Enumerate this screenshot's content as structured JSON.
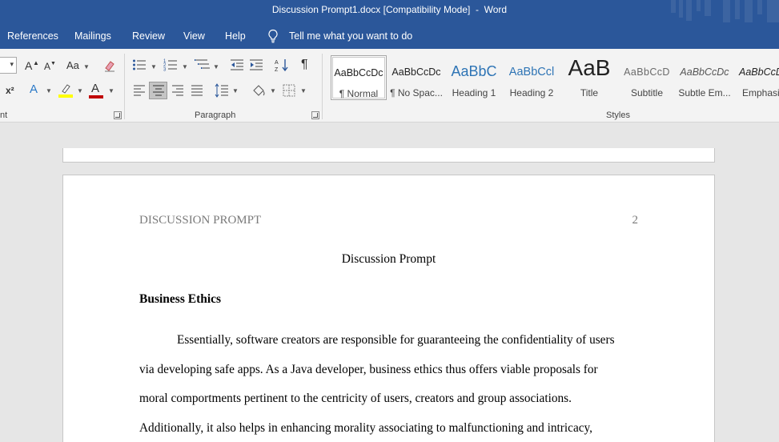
{
  "window": {
    "title": "Discussion Prompt1.docx [Compatibility Mode]  -  Word"
  },
  "menu": {
    "tabs": [
      "References",
      "Mailings",
      "Review",
      "View",
      "Help"
    ],
    "tell_me": "Tell me what you want to do"
  },
  "ribbon": {
    "groups": {
      "font_partial": "nt",
      "paragraph": "Paragraph",
      "styles": "Styles"
    },
    "font_buttons": {
      "grow": "A",
      "shrink": "A",
      "change_case": "Aa",
      "superscript": "x²",
      "text_effects": "A",
      "font_color": "A"
    },
    "highlight_color": "#ffff00",
    "font_color": "#c00000",
    "styles": [
      {
        "preview": "AaBbCcDc",
        "name": "¶ Normal",
        "selected": true
      },
      {
        "preview": "AaBbCcDc",
        "name": "¶ No Spac..."
      },
      {
        "preview": "AaBbC",
        "name": "Heading 1"
      },
      {
        "preview": "AaBbCcl",
        "name": "Heading 2"
      },
      {
        "preview": "AaB",
        "name": "Title"
      },
      {
        "preview": "AaBbCcD",
        "name": "Subtitle"
      },
      {
        "preview": "AaBbCcDc",
        "name": "Subtle Em..."
      },
      {
        "preview": "AaBbCcDc",
        "name": "Emphasis"
      }
    ]
  },
  "document": {
    "header_left": "DISCUSSION PROMPT",
    "page_number": "2",
    "title": "Discussion Prompt",
    "heading": "Business Ethics",
    "lines": [
      "Essentially, software creators are responsible for guaranteeing the confidentiality of users",
      "via developing safe apps. As a Java developer, business ethics thus offers viable proposals for",
      "moral comportments pertinent to the centricity of users, creators and group associations.",
      "Additionally, it also helps in enhancing morality associating to malfunctioning and intricacy,"
    ]
  },
  "colors": {
    "title_bar": "#2b579a",
    "ribbon_bg": "#f3f3f3",
    "canvas_bg": "#e6e6e6"
  }
}
